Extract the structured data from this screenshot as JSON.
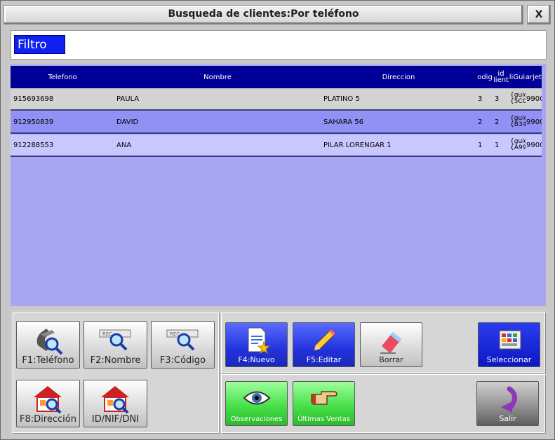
{
  "window": {
    "title": "Busqueda de clientes:Por teléfono",
    "close_label": "X"
  },
  "filter": {
    "label": "Filtro"
  },
  "table": {
    "columns": [
      "Telefono",
      "Nombre",
      "Direccion",
      "odig",
      "id\nlient",
      "liGui",
      "arjet"
    ],
    "rows": [
      {
        "telefono": "915693698",
        "nombre": "PAULA",
        "direccion": "PLATINO 5",
        "codigo": "3",
        "id": "3",
        "guid": "{guic\n{5C0",
        "tarjeta": "9900"
      },
      {
        "telefono": "912950839",
        "nombre": "DAVID",
        "direccion": "SAHARA 56",
        "codigo": "2",
        "id": "2",
        "guid": "{guic\n{B34",
        "tarjeta": "9900"
      },
      {
        "telefono": "912288553",
        "nombre": "ANA",
        "direccion": "PILAR LORENGAR 1",
        "codigo": "1",
        "id": "1",
        "guid": "{guic\n{A99",
        "tarjeta": "9900"
      }
    ]
  },
  "search_buttons": {
    "telefono": "F1:Teléfono",
    "nombre": "F2:Nombre",
    "codigo": "F3:Código",
    "direccion": "F8:Dirección",
    "nif": "ID/NIF/DNI"
  },
  "action_buttons": {
    "nuevo": "F4:Nuevo",
    "editar": "F5:Editar",
    "borrar": "Borrar",
    "seleccionar": "Seleccionar",
    "observaciones": "Observaciones",
    "ultimas_ventas": "Últimas Ventas",
    "salir": "Salir"
  },
  "colors": {
    "header": "#000096",
    "grid_bg": "#a6a6f3",
    "row_odd": "#d3d3d3",
    "row_selected": "#9090f5",
    "row_even": "#c8c8ff",
    "filter_bg": "#1020f0"
  },
  "icons": {
    "telefono": "phone-magnifier-icon",
    "nombre": "record-magnifier-icon",
    "codigo": "record-magnifier-icon",
    "direccion": "house-magnifier-icon",
    "nif": "house-magnifier-icon",
    "nuevo": "new-document-icon",
    "editar": "pencil-icon",
    "borrar": "eraser-icon",
    "seleccionar": "select-screen-icon",
    "observaciones": "eye-icon",
    "ultimas_ventas": "pointing-hand-icon",
    "salir": "exit-arrow-icon"
  }
}
